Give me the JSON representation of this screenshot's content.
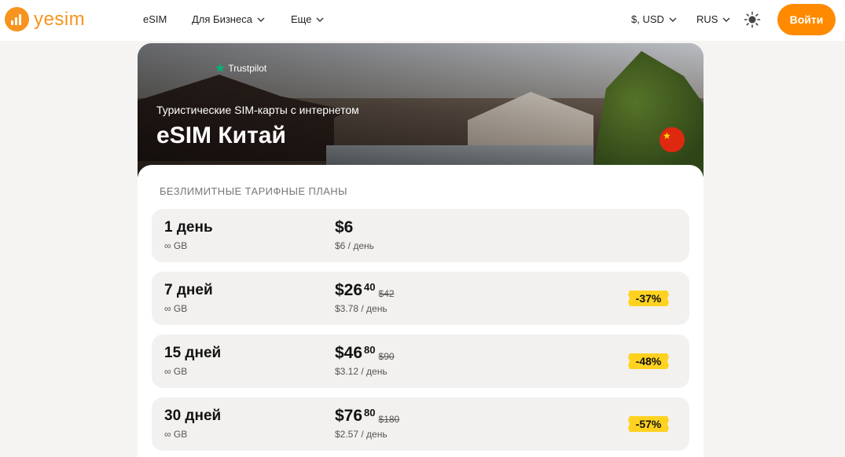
{
  "header": {
    "logo_text": "yesim",
    "nav": [
      {
        "label": "eSIM"
      },
      {
        "label": "Для Бизнеса"
      },
      {
        "label": "Еще"
      }
    ],
    "currency": "$, USD",
    "language": "RUS",
    "login_label": "Войти",
    "accent_color": "#ff8a00"
  },
  "hero": {
    "trustpilot_label": "Trustpilot",
    "subtitle": "Туристические SIM-карты с интернетом",
    "title": "eSIM Китай",
    "flag": "china-flag-icon"
  },
  "plans": {
    "section_title": "БЕЗЛИМИТНЫЕ ТАРИФНЫЕ ПЛАНЫ",
    "items": [
      {
        "name": "1 день",
        "data": "∞ GB",
        "price": "$6",
        "cents": "",
        "old_price": "",
        "per_day": "$6 / день",
        "discount": ""
      },
      {
        "name": "7 дней",
        "data": "∞ GB",
        "price": "$26",
        "cents": "40",
        "old_price": "$42",
        "per_day": "$3.78 / день",
        "discount": "-37%"
      },
      {
        "name": "15 дней",
        "data": "∞ GB",
        "price": "$46",
        "cents": "80",
        "old_price": "$90",
        "per_day": "$3.12 / день",
        "discount": "-48%"
      },
      {
        "name": "30 дней",
        "data": "∞ GB",
        "price": "$76",
        "cents": "80",
        "old_price": "$180",
        "per_day": "$2.57 / день",
        "discount": "-57%"
      }
    ],
    "badge_color": "#ffd21f"
  }
}
